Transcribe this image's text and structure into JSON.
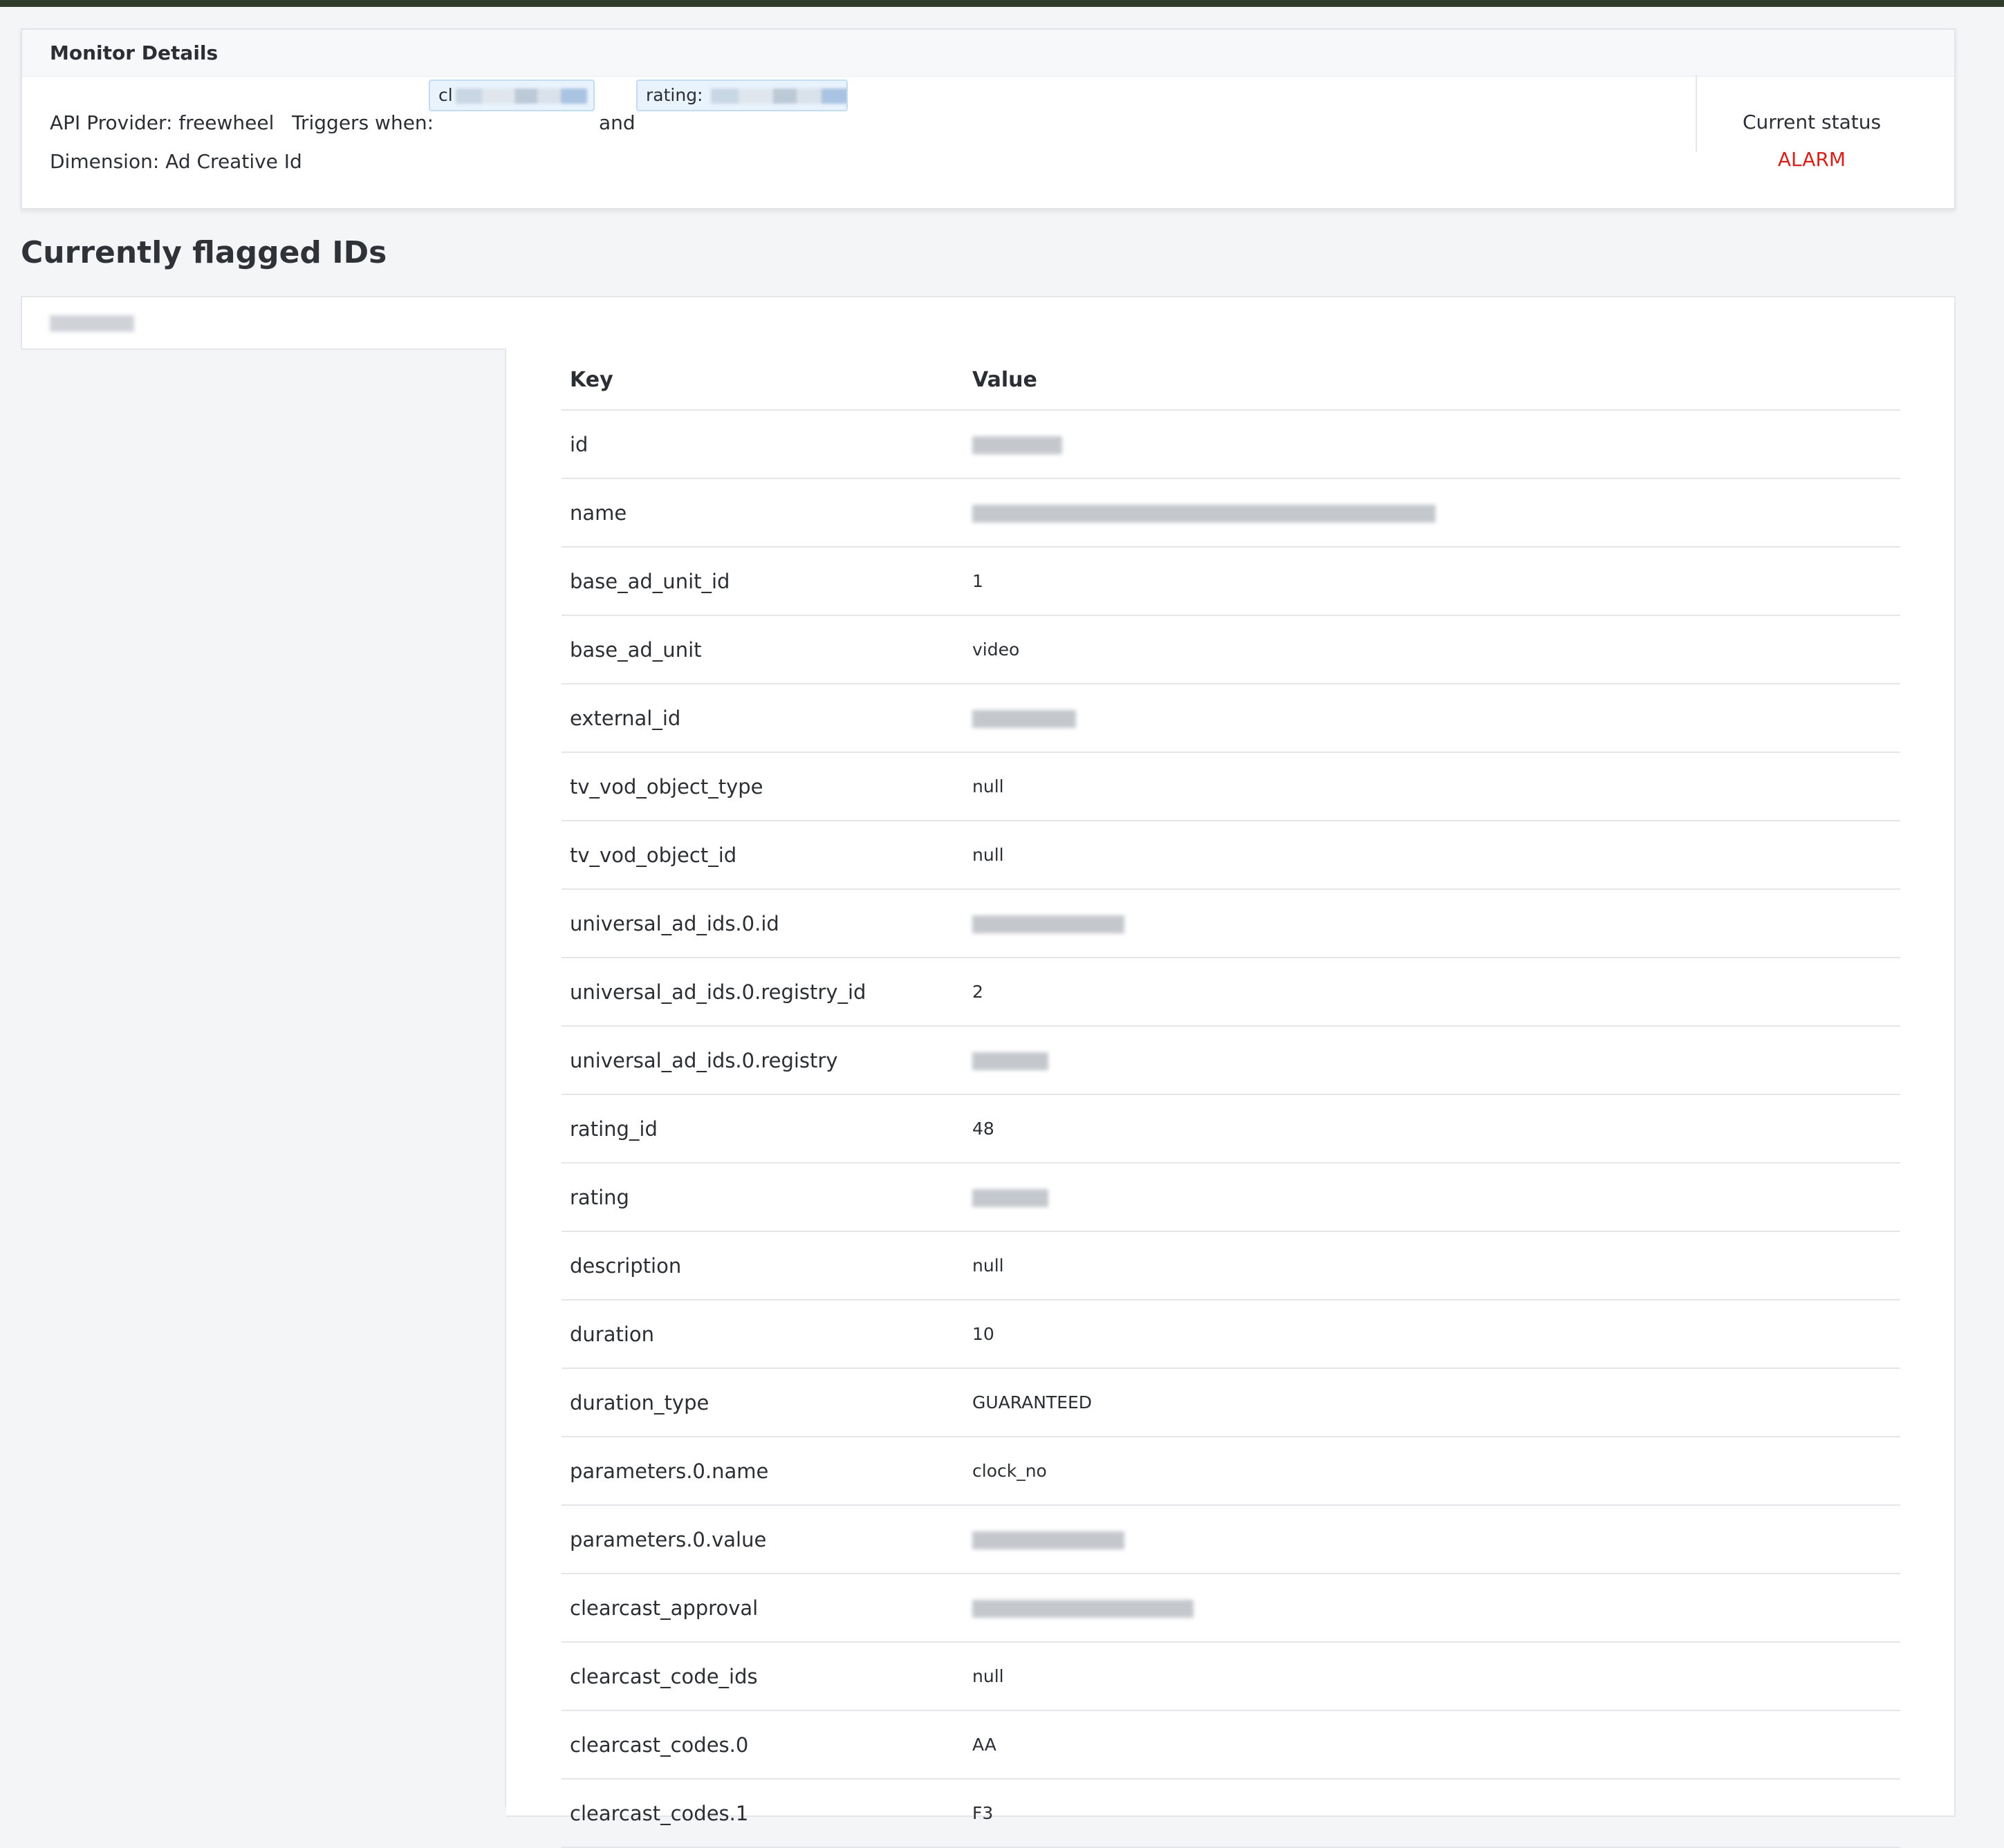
{
  "monitor": {
    "header": "Monitor Details",
    "api_provider": "API Provider: freewheel",
    "dimension": "Dimension: Ad Creative Id",
    "triggers_label": "Triggers when:",
    "chip1_visible": "cl",
    "connector": "and",
    "chip2_visible": "rating: ",
    "status_label": "Current status",
    "status_value": "ALARM",
    "status_color": "#d6211b"
  },
  "flagged": {
    "title": "Currently flagged IDs"
  },
  "table": {
    "key_header": "Key",
    "value_header": "Value",
    "rows": [
      {
        "key": "id",
        "value": "",
        "redacted": true
      },
      {
        "key": "name",
        "value": "",
        "redacted": true
      },
      {
        "key": "base_ad_unit_id",
        "value": "1",
        "redacted": false
      },
      {
        "key": "base_ad_unit",
        "value": "video",
        "redacted": false
      },
      {
        "key": "external_id",
        "value": "",
        "redacted": true
      },
      {
        "key": "tv_vod_object_type",
        "value": "null",
        "redacted": false
      },
      {
        "key": "tv_vod_object_id",
        "value": "null",
        "redacted": false
      },
      {
        "key": "universal_ad_ids.0.id",
        "value": "",
        "redacted": true
      },
      {
        "key": "universal_ad_ids.0.registry_id",
        "value": "2",
        "redacted": false
      },
      {
        "key": "universal_ad_ids.0.registry",
        "value": "",
        "redacted": true
      },
      {
        "key": "rating_id",
        "value": "48",
        "redacted": false
      },
      {
        "key": "rating",
        "value": "",
        "redacted": true
      },
      {
        "key": "description",
        "value": "null",
        "redacted": false
      },
      {
        "key": "duration",
        "value": "10",
        "redacted": false
      },
      {
        "key": "duration_type",
        "value": "GUARANTEED",
        "redacted": false
      },
      {
        "key": "parameters.0.name",
        "value": "clock_no",
        "redacted": false
      },
      {
        "key": "parameters.0.value",
        "value": "",
        "redacted": true
      },
      {
        "key": "clearcast_approval",
        "value": "",
        "redacted": true
      },
      {
        "key": "clearcast_code_ids",
        "value": "null",
        "redacted": false
      },
      {
        "key": "clearcast_codes.0",
        "value": "AA",
        "redacted": false
      },
      {
        "key": "clearcast_codes.1",
        "value": "F3",
        "redacted": false
      }
    ]
  }
}
